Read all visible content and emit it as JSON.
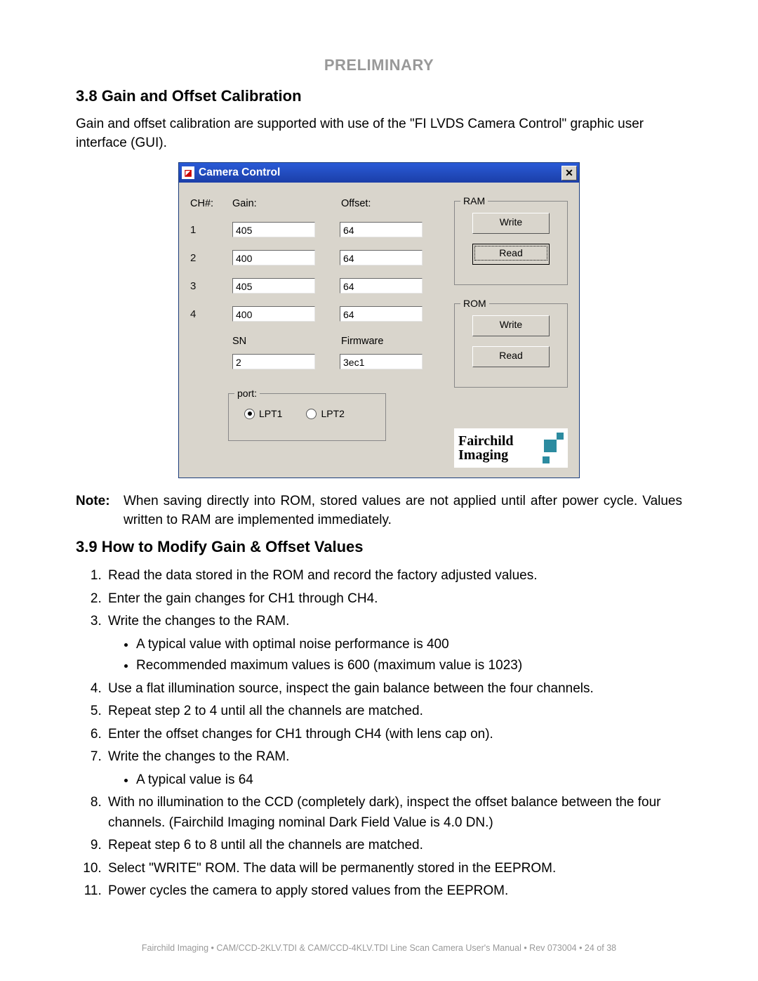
{
  "header": {
    "preliminary": "PRELIMINARY"
  },
  "section38": {
    "heading": "3.8  Gain and Offset Calibration",
    "paragraph": "Gain and offset calibration are supported with use of the \"FI LVDS Camera Control\" graphic user interface (GUI)."
  },
  "dialog": {
    "title": "Camera Control",
    "labels": {
      "ch": "CH#:",
      "gain": "Gain:",
      "offset": "Offset:",
      "sn": "SN",
      "firmware": "Firmware",
      "ram": "RAM",
      "rom": "ROM",
      "port": "port:",
      "write": "Write",
      "read": "Read",
      "lpt1": "LPT1",
      "lpt2": "LPT2"
    },
    "channels": [
      {
        "num": "1",
        "gain": "405",
        "offset": "64"
      },
      {
        "num": "2",
        "gain": "400",
        "offset": "64"
      },
      {
        "num": "3",
        "gain": "405",
        "offset": "64"
      },
      {
        "num": "4",
        "gain": "400",
        "offset": "64"
      }
    ],
    "sn": "2",
    "firmware": "3ec1",
    "port_selected": "LPT1",
    "logo": {
      "line1": "Fairchild",
      "line2": "Imaging"
    }
  },
  "note": {
    "label": "Note:",
    "body": "When saving directly into ROM, stored values are not applied until after power cycle.  Values written to RAM are implemented immediately."
  },
  "section39": {
    "heading": "3.9  How to Modify Gain & Offset Values",
    "steps": [
      "Read the data stored in the ROM and record the factory adjusted values.",
      "Enter the gain changes for CH1 through CH4.",
      "Write the changes to the RAM.",
      "Use a flat illumination source, inspect the gain balance between the four channels.",
      "Repeat step 2 to 4 until all the channels are matched.",
      "Enter the offset changes for CH1 through CH4 (with lens cap on).",
      "Write the changes to the RAM.",
      "With no illumination to the CCD (completely dark), inspect the offset balance between the four channels.  (Fairchild Imaging nominal Dark Field Value is 4.0 DN.)",
      "Repeat step 6 to 8 until all the channels are matched.",
      "Select \"WRITE\" ROM.  The data will be permanently stored in the EEPROM.",
      "Power cycles the camera to apply stored values from the EEPROM."
    ],
    "sub3": [
      "A typical value with optimal noise performance is 400",
      "Recommended maximum values is 600 (maximum value is 1023)"
    ],
    "sub7": [
      "A typical value is 64"
    ]
  },
  "footer": "Fairchild Imaging • CAM/CCD-2KLV.TDI & CAM/CCD-4KLV.TDI Line Scan Camera User's  Manual • Rev 073004 • 24 of 38"
}
